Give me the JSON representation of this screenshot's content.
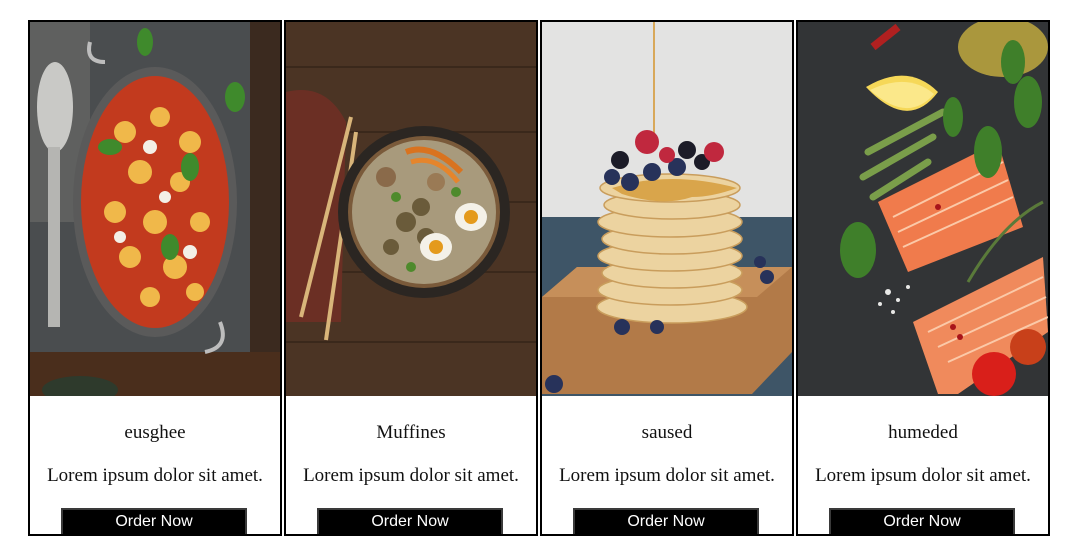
{
  "cards": [
    {
      "title": "eusghee",
      "description": "Lorem ipsum dolor sit amet.",
      "button_label": "Order Now",
      "image": "baked-gnocchi-pan-photo"
    },
    {
      "title": "Muffines",
      "description": "Lorem ipsum dolor sit amet.",
      "button_label": "Order Now",
      "image": "ramen-bowl-photo"
    },
    {
      "title": "saused",
      "description": "Lorem ipsum dolor sit amet.",
      "button_label": "Order Now",
      "image": "pancake-stack-photo"
    },
    {
      "title": "humeded",
      "description": "Lorem ipsum dolor sit amet.",
      "button_label": "Order Now",
      "image": "salmon-herbs-photo"
    }
  ],
  "colors": {
    "card_border": "#000000",
    "button_bg": "#000000",
    "button_text": "#ffffff"
  }
}
